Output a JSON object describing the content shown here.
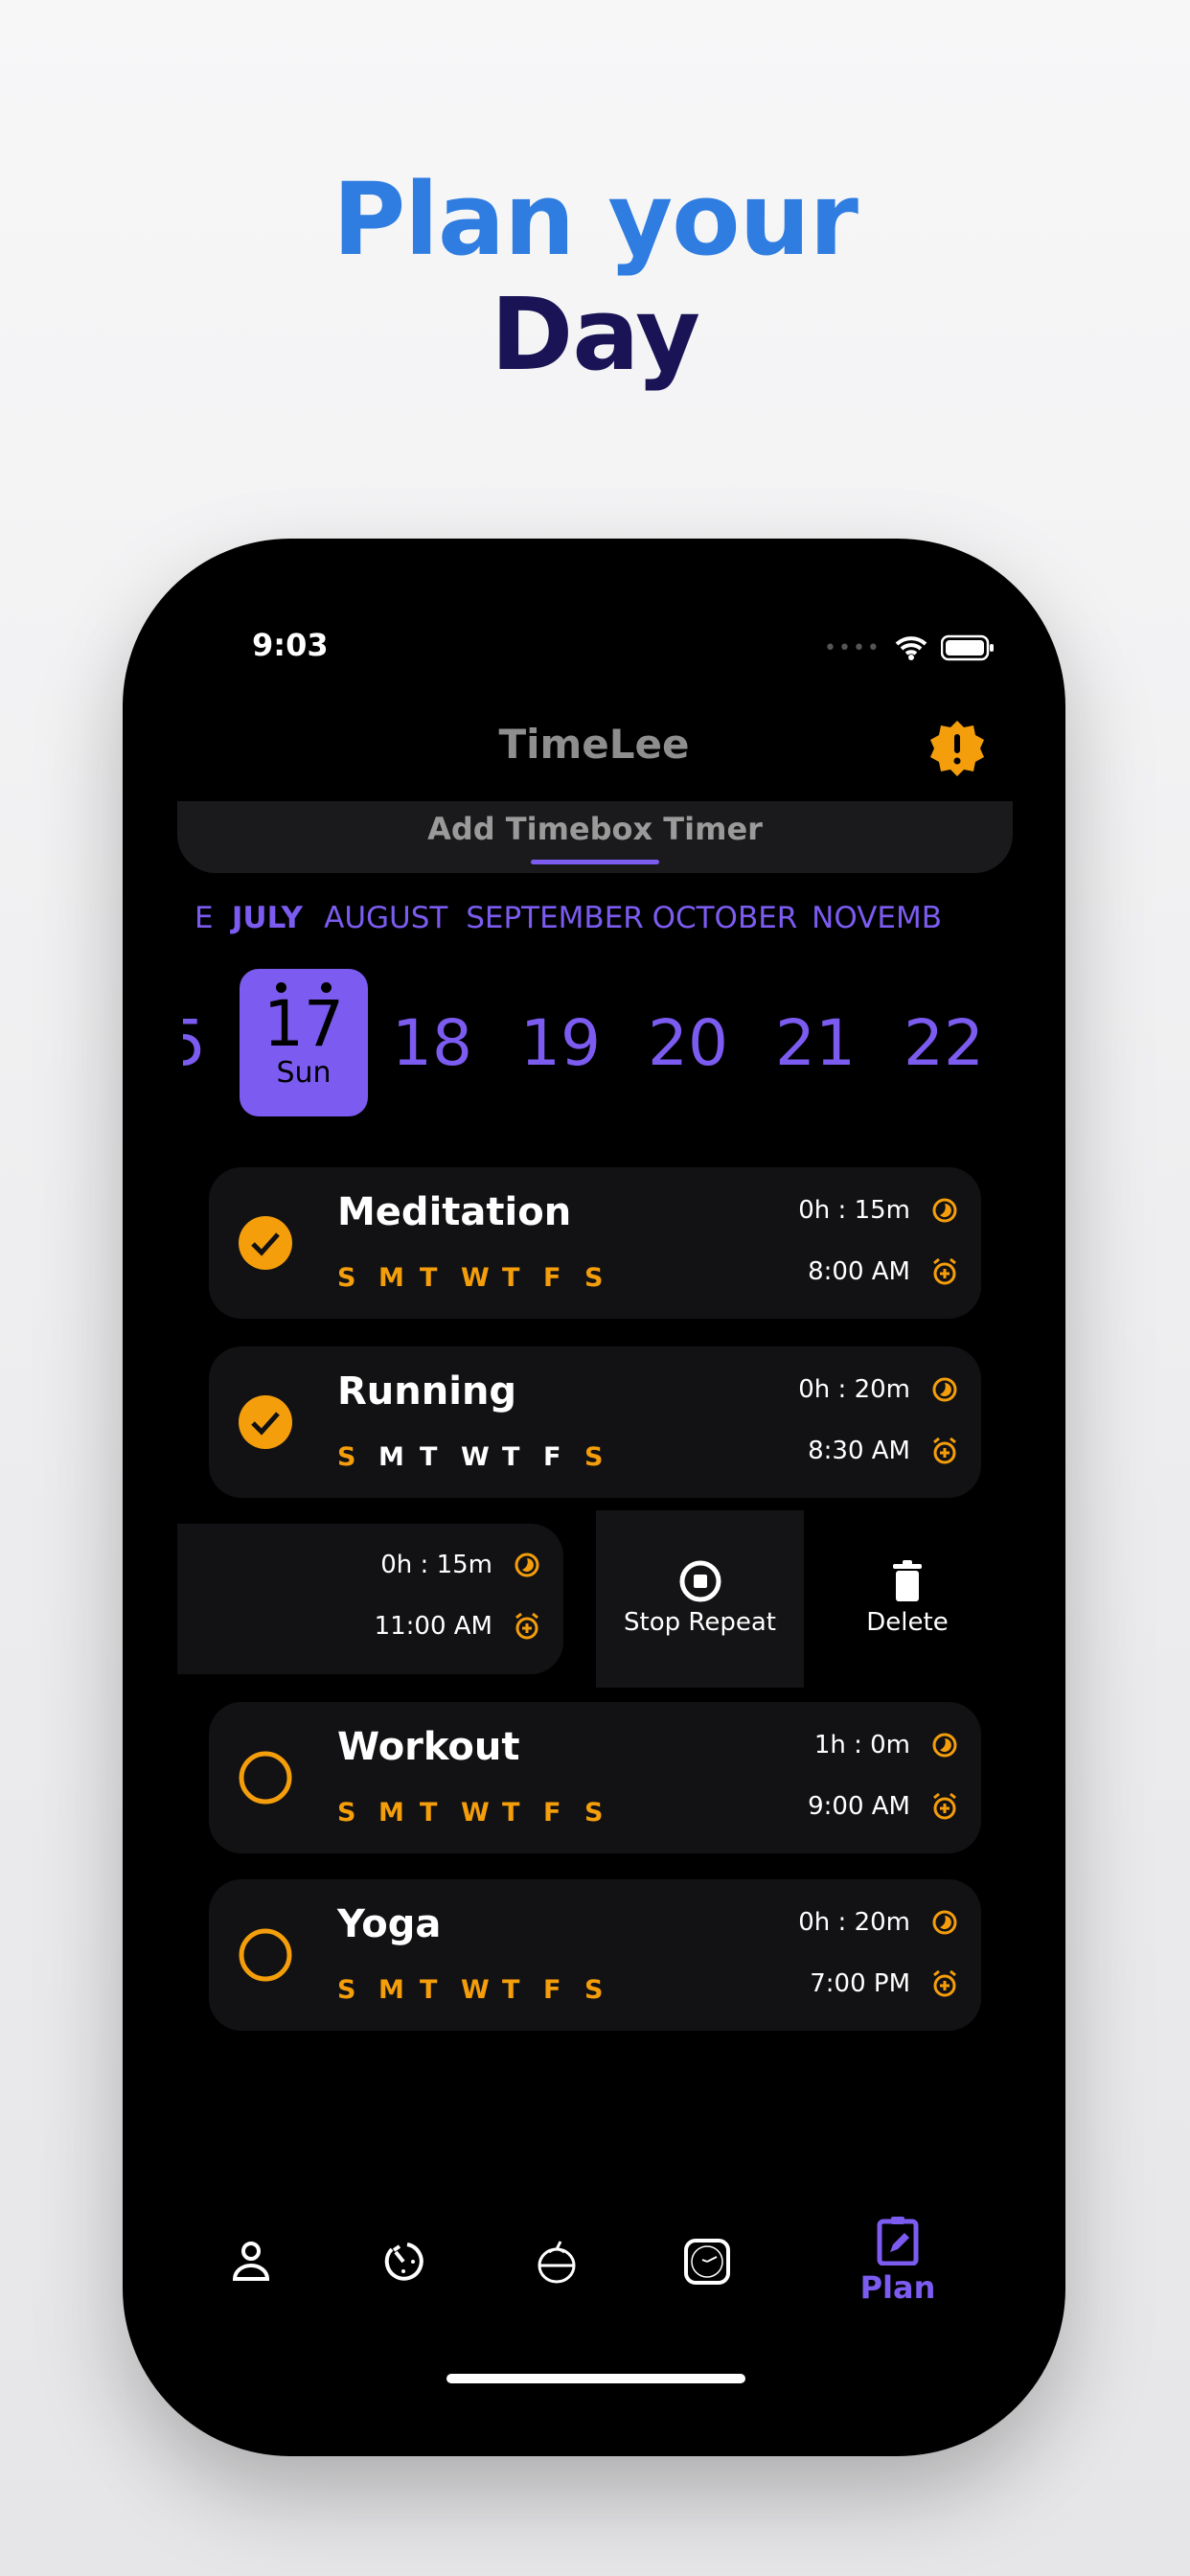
{
  "headline": {
    "line1": "Plan your",
    "line2": "Day",
    "color1": "#2f7de1",
    "color2": "#1a1456"
  },
  "status": {
    "time": "9:03"
  },
  "app": {
    "title": "TimeLee",
    "add_tab": "Add Timebox Timer",
    "accent": "#7c5cf0",
    "orange": "#f59e0b"
  },
  "months": [
    "E",
    "JULY",
    "AUGUST",
    "SEPTEMBER",
    "OCTOBER",
    "NOVEMB"
  ],
  "selected_month": "JULY",
  "dates": {
    "prev": "5",
    "selected": {
      "day": "17",
      "weekday": "Sun"
    },
    "others": [
      "18",
      "19",
      "20",
      "21",
      "22"
    ]
  },
  "tasks": [
    {
      "name": "Meditation",
      "duration": "0h : 15m",
      "time": "8:00 AM",
      "done": true,
      "days": [
        "S",
        "M",
        "T",
        "W",
        "T",
        "F",
        "S"
      ],
      "active": [
        1,
        1,
        1,
        1,
        1,
        1,
        1
      ]
    },
    {
      "name": "Running",
      "duration": "0h : 20m",
      "time": "8:30 AM",
      "done": true,
      "days": [
        "S",
        "M",
        "T",
        "W",
        "T",
        "F",
        "S"
      ],
      "active": [
        1,
        0,
        0,
        0,
        0,
        0,
        1
      ]
    },
    {
      "name": "",
      "duration": "0h : 15m",
      "time": "11:00 AM",
      "done": false,
      "swiped": true
    },
    {
      "name": "Workout",
      "duration": "1h : 0m",
      "time": "9:00 AM",
      "done": false,
      "days": [
        "S",
        "M",
        "T",
        "W",
        "T",
        "F",
        "S"
      ],
      "active": [
        1,
        1,
        1,
        1,
        1,
        1,
        1
      ]
    },
    {
      "name": "Yoga",
      "duration": "0h : 20m",
      "time": "7:00 PM",
      "done": false,
      "days": [
        "S",
        "M",
        "T",
        "W",
        "T",
        "F",
        "S"
      ],
      "active": [
        1,
        1,
        1,
        1,
        1,
        1,
        1
      ]
    }
  ],
  "swipe_actions": {
    "stop_repeat": "Stop Repeat",
    "delete": "Delete"
  },
  "nav": {
    "items": [
      "profile-icon",
      "timer-icon",
      "kitchen-timer-icon",
      "clock-icon",
      "plan-icon"
    ],
    "active_label": "Plan"
  }
}
